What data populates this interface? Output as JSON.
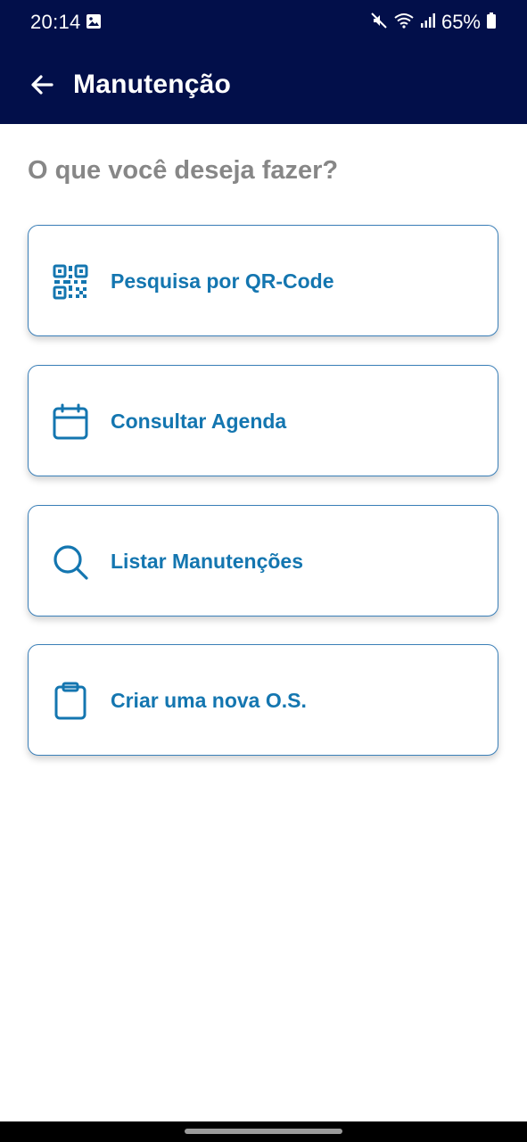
{
  "status_bar": {
    "time": "20:14",
    "battery": "65%",
    "icons": [
      "image-icon",
      "mute-icon",
      "wifi-icon",
      "signal-icon",
      "battery-icon"
    ]
  },
  "app_bar": {
    "title": "Manutenção",
    "back_icon": "arrow-left-icon"
  },
  "main": {
    "question": "O que você deseja fazer?",
    "options": [
      {
        "label": "Pesquisa por QR-Code",
        "icon": "qr-code-icon"
      },
      {
        "label": "Consultar Agenda",
        "icon": "calendar-icon"
      },
      {
        "label": "Listar Manutenções",
        "icon": "search-icon"
      },
      {
        "label": "Criar uma nova O.S.",
        "icon": "clipboard-icon"
      }
    ]
  },
  "colors": {
    "header_bg": "#020f4a",
    "accent": "#1476b0",
    "card_border": "#3a7fb8",
    "question_text": "#878787"
  }
}
